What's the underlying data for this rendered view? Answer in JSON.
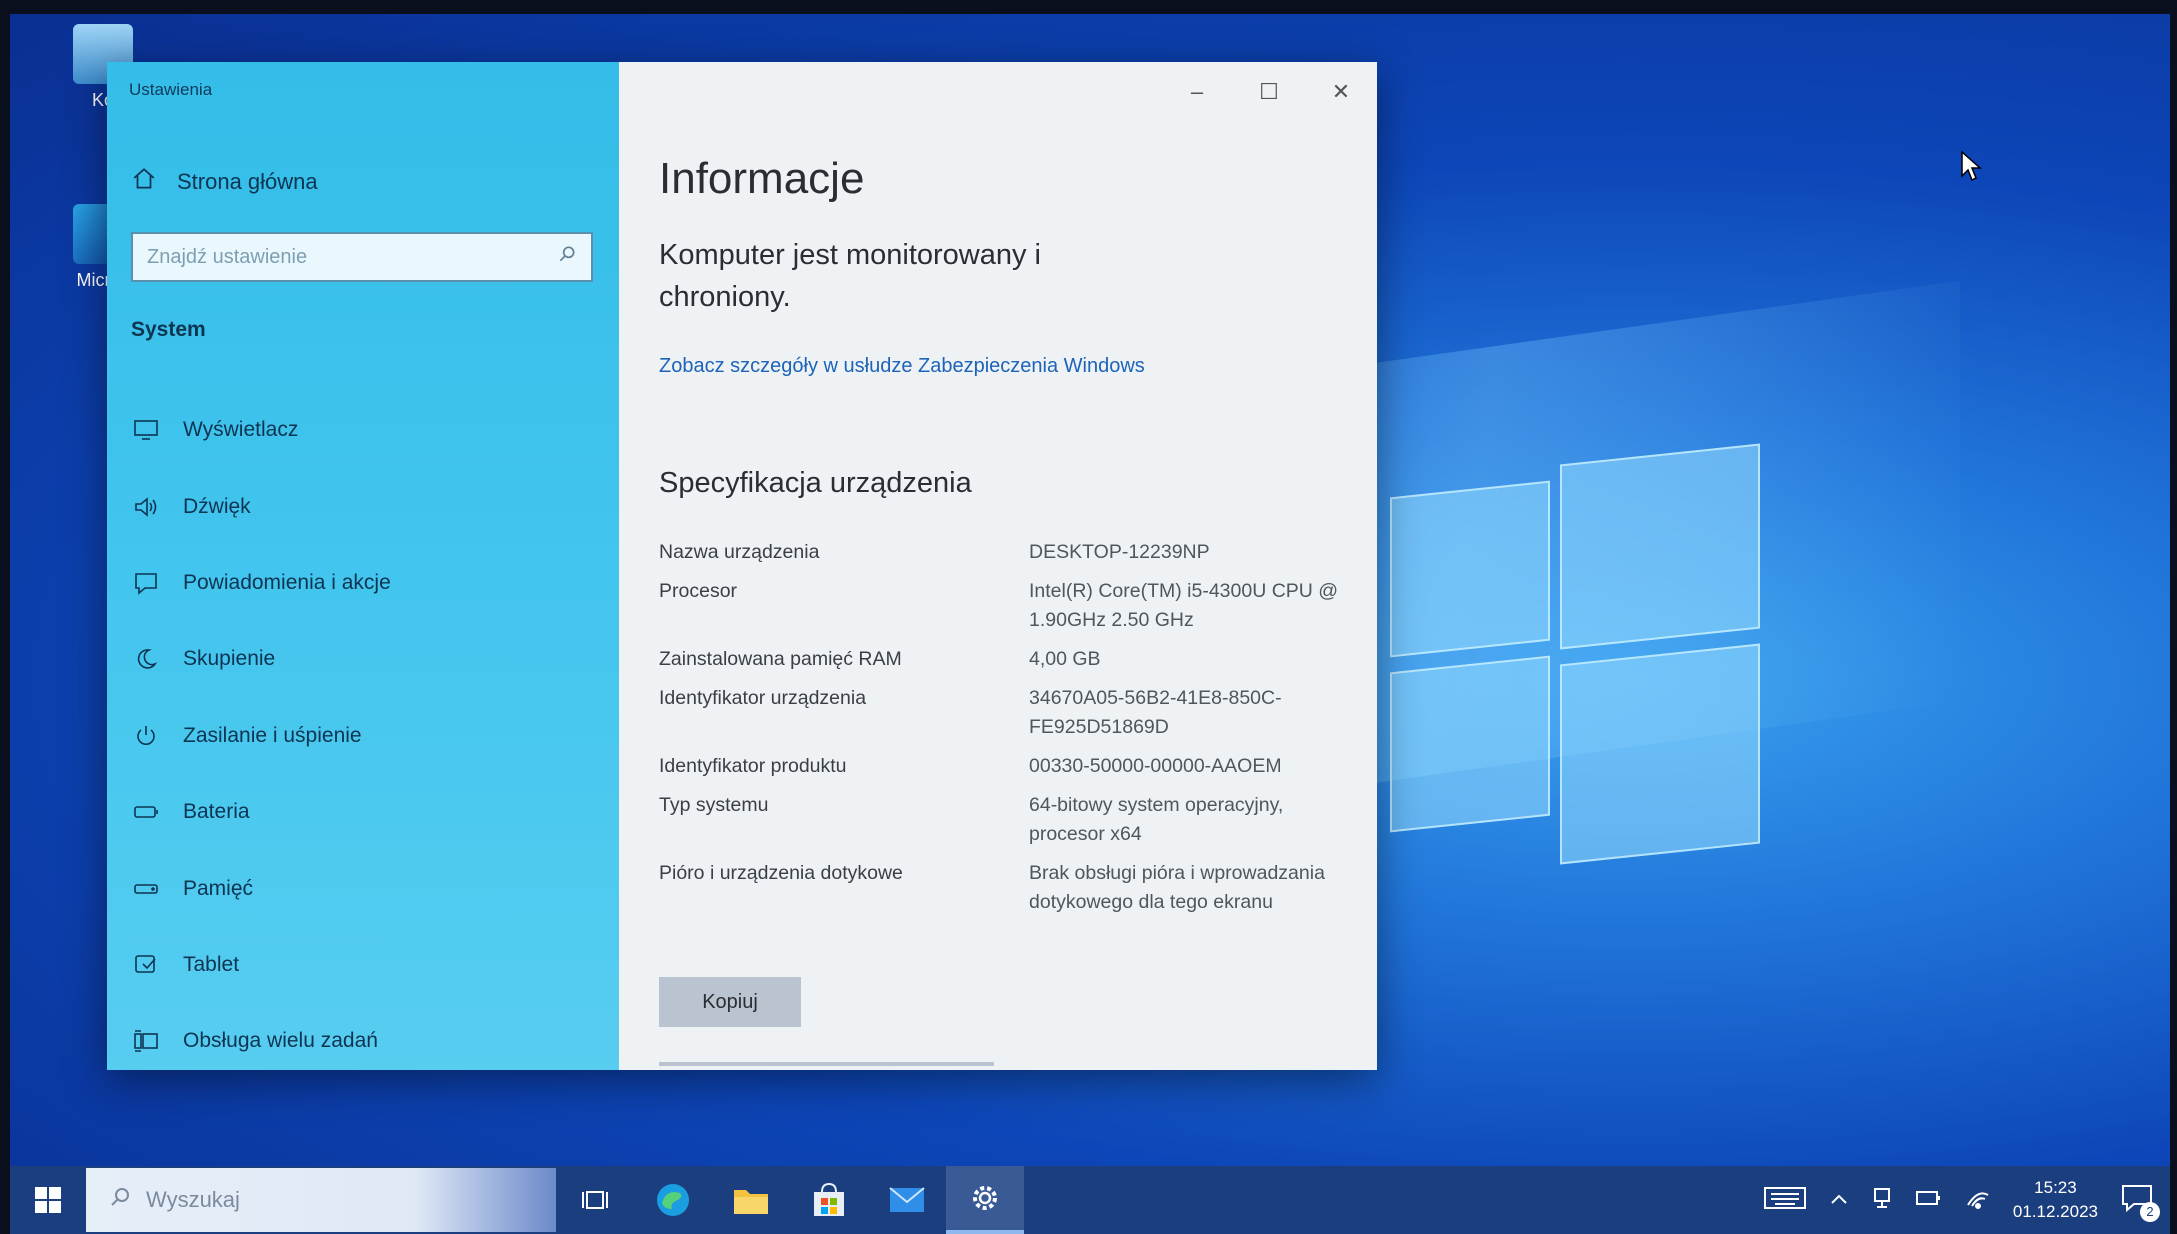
{
  "desktop": {
    "icons": [
      {
        "label": "Ko",
        "icon": "recycle-bin-icon"
      },
      {
        "label": "Micros",
        "icon": "edge-shortcut-icon"
      }
    ]
  },
  "window": {
    "title": "Ustawienia",
    "controls": {
      "minimize": "–",
      "maximize": "☐",
      "close": "✕"
    }
  },
  "sidebar": {
    "home_label": "Strona główna",
    "search_placeholder": "Znajdź ustawienie",
    "section": "System",
    "items": [
      {
        "label": "Wyświetlacz",
        "icon": "display-icon"
      },
      {
        "label": "Dźwięk",
        "icon": "speaker-icon"
      },
      {
        "label": "Powiadomienia i akcje",
        "icon": "notification-icon"
      },
      {
        "label": "Skupienie",
        "icon": "moon-icon"
      },
      {
        "label": "Zasilanie i uśpienie",
        "icon": "power-icon"
      },
      {
        "label": "Bateria",
        "icon": "battery-icon"
      },
      {
        "label": "Pamięć",
        "icon": "storage-icon"
      },
      {
        "label": "Tablet",
        "icon": "tablet-icon"
      },
      {
        "label": "Obsługa wielu zadań",
        "icon": "multitasking-icon"
      }
    ]
  },
  "content": {
    "title": "Informacje",
    "status": "Komputer jest monitorowany i chroniony.",
    "link": "Zobacz szczegóły w usłudze Zabezpieczenia Windows",
    "spec_heading": "Specyfikacja urządzenia",
    "specs": [
      {
        "key": "Nazwa urządzenia",
        "value": "DESKTOP-12239NP"
      },
      {
        "key": "Procesor",
        "value": "Intel(R) Core(TM) i5-4300U CPU @ 1.90GHz   2.50 GHz"
      },
      {
        "key": "Zainstalowana pamięć RAM",
        "value": "4,00 GB"
      },
      {
        "key": "Identyfikator urządzenia",
        "value": "34670A05-56B2-41E8-850C-FE925D51869D"
      },
      {
        "key": "Identyfikator produktu",
        "value": "00330-50000-00000-AAOEM"
      },
      {
        "key": "Typ systemu",
        "value": "64-bitowy system operacyjny, procesor x64"
      },
      {
        "key": "Pióro i urządzenia dotykowe",
        "value": "Brak obsługi pióra i wprowadzania dotykowego dla tego ekranu"
      }
    ],
    "copy_button": "Kopiuj"
  },
  "taskbar": {
    "search_placeholder": "Wyszukaj",
    "pinned": [
      "task-view-icon",
      "edge-icon",
      "file-explorer-icon",
      "store-icon",
      "mail-icon",
      "settings-icon"
    ],
    "time": "15:23",
    "date": "01.12.2023",
    "notification_count": "2"
  }
}
